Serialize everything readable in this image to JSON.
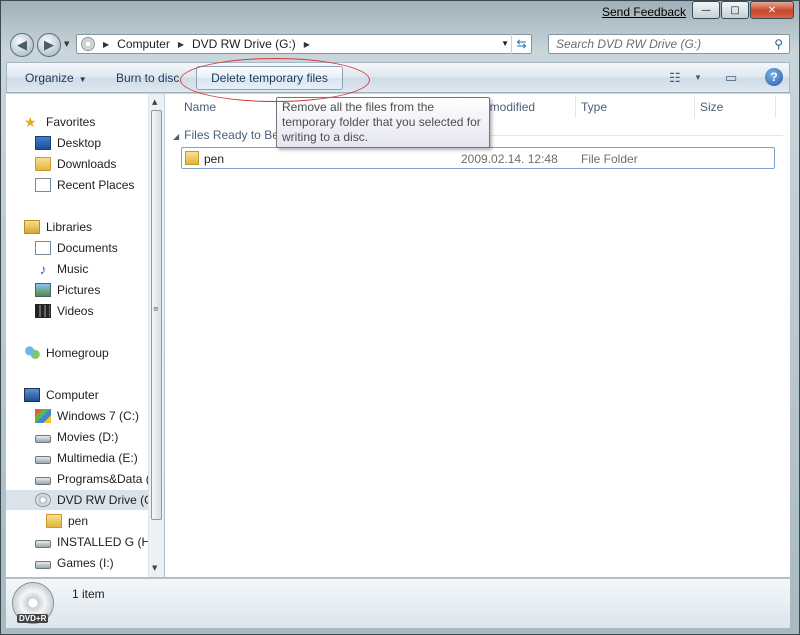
{
  "window": {
    "send_feedback": "Send Feedback",
    "controls": {
      "minimize": "—",
      "maximize": "□",
      "close": "✕"
    }
  },
  "address_bar": {
    "breadcrumbs": [
      "Computer",
      "DVD RW Drive (G:)"
    ],
    "icon": "dvd-drive-icon"
  },
  "search": {
    "placeholder": "Search DVD RW Drive (G:)"
  },
  "toolbar": {
    "organize": "Organize",
    "burn": "Burn to disc",
    "delete_temp": "Delete temporary files"
  },
  "tooltip": {
    "text": "Remove all the files from the temporary folder that you selected for writing to a disc."
  },
  "nav": {
    "favorites": {
      "label": "Favorites",
      "items": [
        "Desktop",
        "Downloads",
        "Recent Places"
      ]
    },
    "libraries": {
      "label": "Libraries",
      "items": [
        "Documents",
        "Music",
        "Pictures",
        "Videos"
      ]
    },
    "homegroup": "Homegroup",
    "computer": {
      "label": "Computer",
      "items": [
        "Windows 7 (C:)",
        "Movies (D:)",
        "Multimedia (E:)",
        "Programs&Data (",
        "DVD RW Drive (G:",
        "pen",
        "INSTALLED G (H:",
        "Games (I:)"
      ]
    }
  },
  "columns": {
    "name": "Name",
    "date_modified": "Date modified",
    "type": "Type",
    "size": "Size"
  },
  "group": {
    "label": "Files Ready to Be Written to the Disc"
  },
  "files": [
    {
      "name": "pen",
      "date": "2009.02.14. 12:48",
      "type": "File Folder",
      "size": ""
    }
  ],
  "details": {
    "item_count": "1 item",
    "drive_badge": "DVD+R"
  },
  "colors": {
    "accent": "#1e395b",
    "highlight_ring": "#d63a3a",
    "selection": "#7da2ce"
  }
}
